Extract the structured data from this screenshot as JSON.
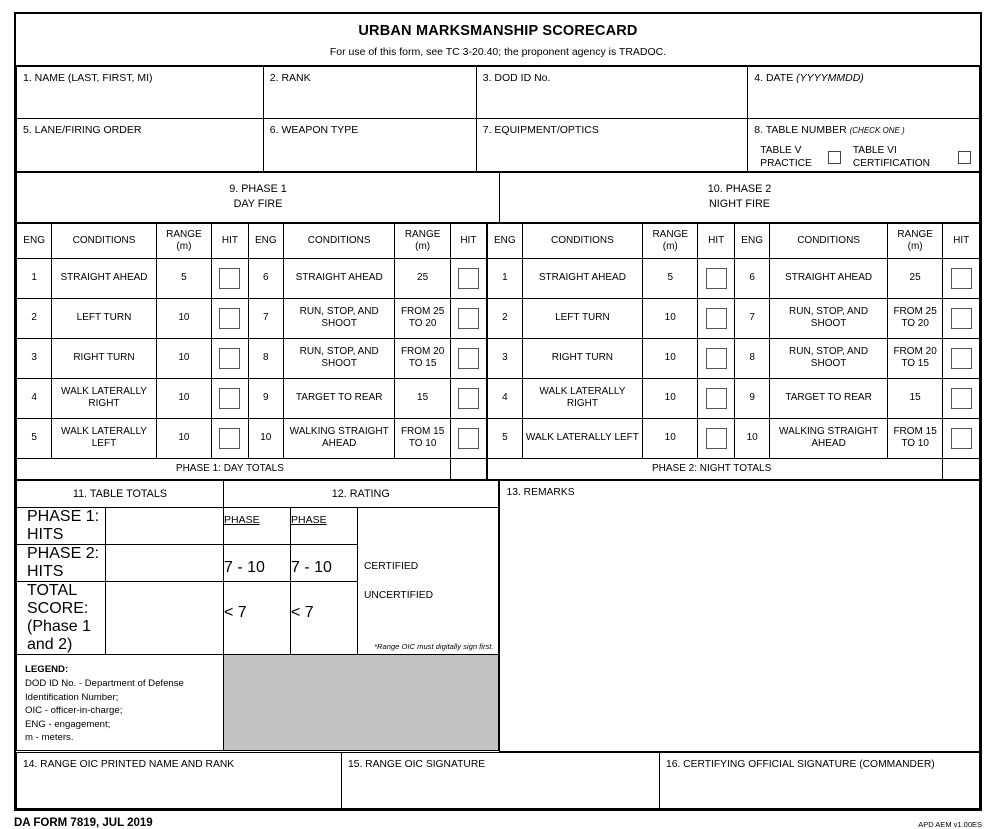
{
  "form": {
    "title": "URBAN MARKSMANSHIP SCORECARD",
    "subtitle": "For use of this form, see TC 3-20.40; the proponent agency is TRADOC.",
    "footer_form_id": "DA FORM 7819, JUL 2019",
    "footer_version": "APD AEM v1.00ES"
  },
  "header": {
    "name_label": "1. NAME (LAST, FIRST, MI)",
    "rank_label": "2. RANK",
    "dod_label": "3. DOD ID No.",
    "date_label": "4. DATE",
    "date_format": "(YYYYMMDD)",
    "lane_label": "5. LANE/FIRING ORDER",
    "weapon_label": "6. WEAPON TYPE",
    "equipment_label": "7. EQUIPMENT/OPTICS",
    "table_number_label": "8. TABLE NUMBER",
    "table_number_hint": "(CHECK ONE )",
    "table_v_line1": "TABLE V",
    "table_v_line2": "PRACTICE",
    "table_vi_line1": "TABLE VI",
    "table_vi_line2": "CERTIFICATION",
    "name_value": "",
    "rank_value": "",
    "dod_value": "",
    "date_value": "",
    "lane_value": "",
    "weapon_value": "",
    "equipment_value": ""
  },
  "phase1": {
    "banner_line1": "9. PHASE 1",
    "banner_line2": "DAY FIRE",
    "totals_label": "PHASE 1:  DAY TOTALS",
    "totals_value": "",
    "columns": [
      "ENG",
      "CONDITIONS",
      "RANGE",
      "HIT"
    ],
    "range_unit": "(m)",
    "rows": [
      {
        "eng_l": "1",
        "cond_l": "STRAIGHT AHEAD",
        "rng_l": "5",
        "hit_l": "",
        "eng_r": "6",
        "cond_r": "STRAIGHT AHEAD",
        "rng_r": "25",
        "hit_r": ""
      },
      {
        "eng_l": "2",
        "cond_l": "LEFT TURN",
        "rng_l": "10",
        "hit_l": "",
        "eng_r": "7",
        "cond_r": "RUN, STOP, AND SHOOT",
        "rng_r": "FROM 25 TO 20",
        "hit_r": ""
      },
      {
        "eng_l": "3",
        "cond_l": "RIGHT TURN",
        "rng_l": "10",
        "hit_l": "",
        "eng_r": "8",
        "cond_r": "RUN, STOP, AND SHOOT",
        "rng_r": "FROM 20 TO 15",
        "hit_r": ""
      },
      {
        "eng_l": "4",
        "cond_l": "WALK LATERALLY RIGHT",
        "rng_l": "10",
        "hit_l": "",
        "eng_r": "9",
        "cond_r": "TARGET TO REAR",
        "rng_r": "15",
        "hit_r": ""
      },
      {
        "eng_l": "5",
        "cond_l": "WALK LATERALLY LEFT",
        "rng_l": "10",
        "hit_l": "",
        "eng_r": "10",
        "cond_r": "WALKING STRAIGHT AHEAD",
        "rng_r": "FROM 15 TO 10",
        "hit_r": ""
      }
    ]
  },
  "phase2": {
    "banner_line1": "10. PHASE 2",
    "banner_line2": "NIGHT FIRE",
    "totals_label": "PHASE 2:  NIGHT TOTALS",
    "totals_value": "",
    "columns": [
      "ENG",
      "CONDITIONS",
      "RANGE",
      "HIT"
    ],
    "range_unit": "(m)",
    "rows": [
      {
        "eng_l": "1",
        "cond_l": "STRAIGHT AHEAD",
        "rng_l": "5",
        "hit_l": "",
        "eng_r": "6",
        "cond_r": "STRAIGHT AHEAD",
        "rng_r": "25",
        "hit_r": ""
      },
      {
        "eng_l": "2",
        "cond_l": "LEFT TURN",
        "rng_l": "10",
        "hit_l": "",
        "eng_r": "7",
        "cond_r": "RUN, STOP, AND SHOOT",
        "rng_r": "FROM 25 TO 20",
        "hit_r": ""
      },
      {
        "eng_l": "3",
        "cond_l": "RIGHT TURN",
        "rng_l": "10",
        "hit_l": "",
        "eng_r": "8",
        "cond_r": "RUN, STOP, AND SHOOT",
        "rng_r": "FROM 20 TO 15",
        "hit_r": ""
      },
      {
        "eng_l": "4",
        "cond_l": "WALK LATERALLY RIGHT",
        "rng_l": "10",
        "hit_l": "",
        "eng_r": "9",
        "cond_r": "TARGET TO REAR",
        "rng_r": "15",
        "hit_r": ""
      },
      {
        "eng_l": "5",
        "cond_l": "WALK LATERALLY LEFT",
        "rng_l": "10",
        "hit_l": "",
        "eng_r": "10",
        "cond_r": "WALKING STRAIGHT AHEAD",
        "rng_r": "FROM 15 TO 10",
        "hit_r": ""
      }
    ]
  },
  "table_totals": {
    "section_label": "11.  TABLE TOTALS",
    "rows": [
      {
        "label": "PHASE 1: HITS",
        "value": ""
      },
      {
        "label": "PHASE 2: HITS",
        "value": ""
      }
    ],
    "total_label_line1": "TOTAL SCORE:",
    "total_label_line2": "(Phase 1 and  2)",
    "total_value": ""
  },
  "rating": {
    "section_label": "12. RATING",
    "col1_head": "PHASE",
    "col2_head": "PHASE",
    "col1_v1": "7 - 10",
    "col1_v2": "< 7",
    "col2_v1": "7 - 10",
    "col2_v2": "< 7",
    "certified": "CERTIFIED",
    "uncertified": "UNCERTIFIED",
    "note": "*Range OIC must digitally sign first."
  },
  "remarks": {
    "label": "13. REMARKS",
    "value": ""
  },
  "legend": {
    "title": "LEGEND:",
    "lines": [
      "DOD ID No. - Department of Defense",
      "Identification Number;",
      "OIC - officer-in-charge;",
      "ENG - engagement;",
      "m - meters."
    ]
  },
  "signatures": {
    "oic_name_label": "14. RANGE OIC PRINTED NAME AND RANK",
    "oic_sig_label": "15. RANGE OIC SIGNATURE",
    "cert_sig_label": "16. CERTIFYING OFFICIAL SIGNATURE (COMMANDER)",
    "oic_name_value": "",
    "oic_sig_value": "",
    "cert_sig_value": ""
  },
  "colors": {
    "shaded_block": "#c2c2c2",
    "border": "#000000",
    "paper": "#ffffff"
  }
}
